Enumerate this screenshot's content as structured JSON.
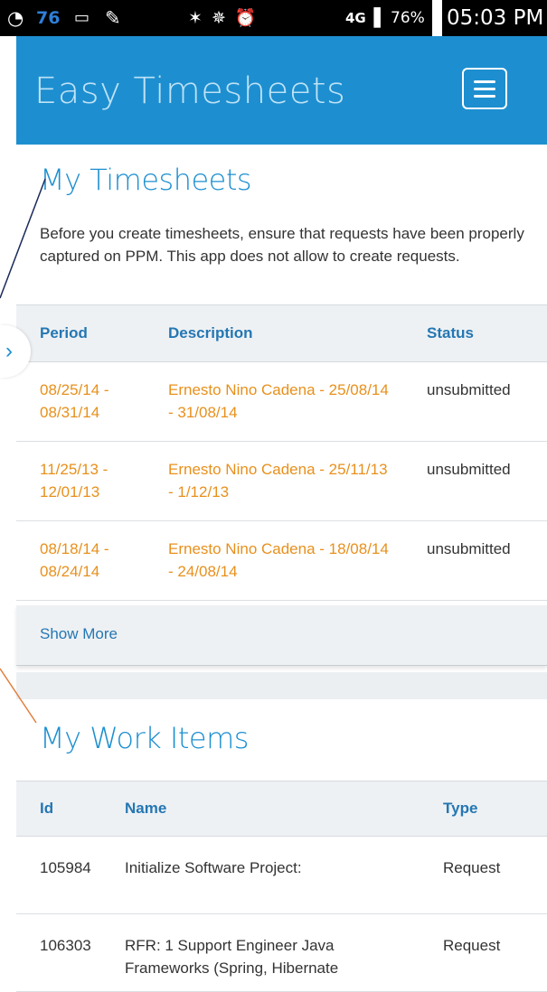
{
  "status_bar": {
    "notification_count": "76",
    "battery_percent": "76%",
    "network": "4G",
    "time": "05:03 PM"
  },
  "header": {
    "title": "Easy Timesheets",
    "menu_icon": "hamburger-menu-icon"
  },
  "timesheets": {
    "title": "My Timesheets",
    "intro": "Before you create timesheets, ensure that requests have been properly captured on PPM. This app does not allow to create requests.",
    "columns": [
      "Period",
      "Description",
      "Status"
    ],
    "rows": [
      {
        "period": "08/25/14 - 08/31/14",
        "description": "Ernesto Nino Cadena - 25/08/14 - 31/08/14",
        "status": "unsubmitted"
      },
      {
        "period": "11/25/13 - 12/01/13",
        "description": "Ernesto Nino Cadena - 25/11/13 - 1/12/13",
        "status": "unsubmitted"
      },
      {
        "period": "08/18/14 - 08/24/14",
        "description": "Ernesto Nino Cadena - 18/08/14 - 24/08/14",
        "status": "unsubmitted"
      }
    ],
    "show_more": "Show More"
  },
  "work_items": {
    "title": "My Work Items",
    "columns": [
      "Id",
      "Name",
      "Type"
    ],
    "rows": [
      {
        "id": "105984",
        "name": "Initialize Software Project:",
        "type": "Request"
      },
      {
        "id": "106303",
        "name": "RFR: 1 Support Engineer Java Frameworks (Spring, Hibernate",
        "type": "Request"
      }
    ]
  },
  "colors": {
    "brand_blue": "#1d8fd0",
    "link_orange": "#e8901c",
    "header_text": "#2477b3"
  }
}
